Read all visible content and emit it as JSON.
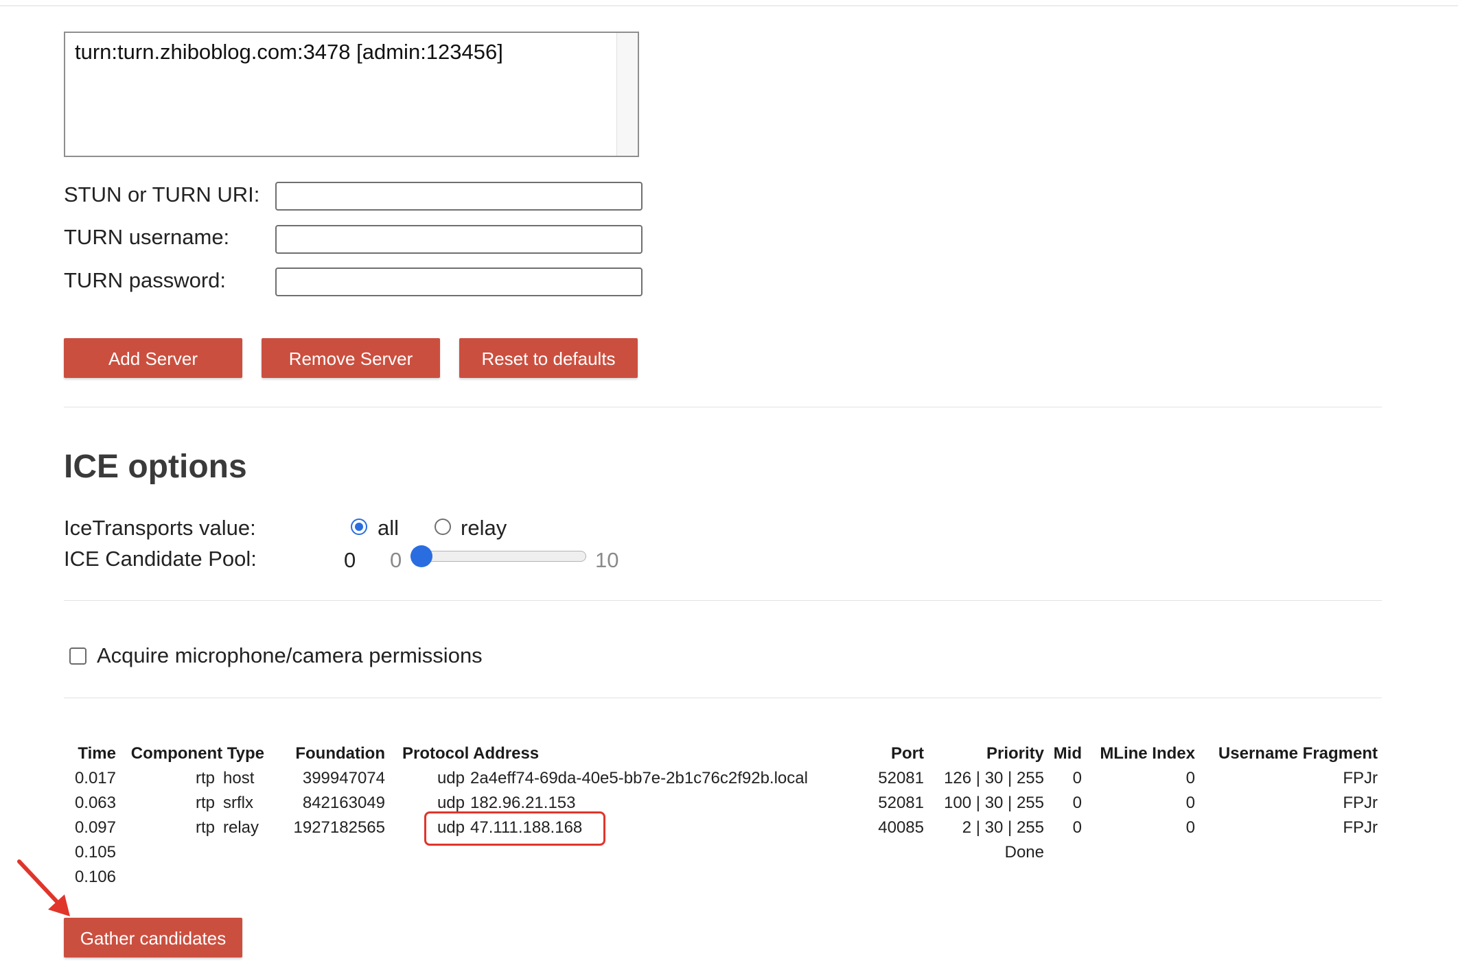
{
  "ice_servers": {
    "entries": [
      "turn:turn.zhiboblog.com:3478 [admin:123456]"
    ],
    "fields": {
      "uri_label": "STUN or TURN URI:",
      "uri_value": "",
      "username_label": "TURN username:",
      "username_value": "",
      "password_label": "TURN password:",
      "password_value": ""
    },
    "buttons": {
      "add": "Add Server",
      "remove": "Remove Server",
      "reset": "Reset to defaults"
    }
  },
  "ice_options": {
    "heading": "ICE options",
    "transports_label": "IceTransports value:",
    "transport_options": [
      "all",
      "relay"
    ],
    "transport_selected": "all",
    "pool_label": "ICE Candidate Pool:",
    "pool_value": "0",
    "pool_min": "0",
    "pool_max": "10",
    "pool_fraction": 0
  },
  "permissions": {
    "label": "Acquire microphone/camera permissions",
    "checked": false
  },
  "candidates": {
    "columns": [
      "Time",
      "Component Type",
      "Foundation",
      "Protocol Address",
      "Port",
      "Priority",
      "Mid",
      "MLine Index",
      "Username Fragment"
    ],
    "rows": [
      {
        "time": "0.017",
        "component": "rtp",
        "type": "host",
        "foundation": "399947074",
        "protocol": "udp",
        "address": "2a4eff74-69da-40e5-bb7e-2b1c76c2f92b.local",
        "port": "52081",
        "priority": "126 | 30 | 255",
        "mid": "0",
        "mline": "0",
        "ufrag": "FPJr"
      },
      {
        "time": "0.063",
        "component": "rtp",
        "type": "srflx",
        "foundation": "842163049",
        "protocol": "udp",
        "address": "182.96.21.153",
        "port": "52081",
        "priority": "100 | 30 | 255",
        "mid": "0",
        "mline": "0",
        "ufrag": "FPJr"
      },
      {
        "time": "0.097",
        "component": "rtp",
        "type": "relay",
        "foundation": "1927182565",
        "protocol": "udp",
        "address": "47.111.188.168",
        "port": "40085",
        "priority": "2 | 30 | 255",
        "mid": "0",
        "mline": "0",
        "ufrag": "FPJr"
      }
    ],
    "extra_rows": [
      {
        "time": "0.105",
        "status": "Done"
      },
      {
        "time": "0.106",
        "status": ""
      }
    ],
    "gather_button": "Gather candidates"
  },
  "colors": {
    "button": "#cb4f3f",
    "accent": "#2a6de0",
    "annotation": "#e0352b"
  },
  "icons": {
    "annotation_arrow": "arrow-icon"
  }
}
